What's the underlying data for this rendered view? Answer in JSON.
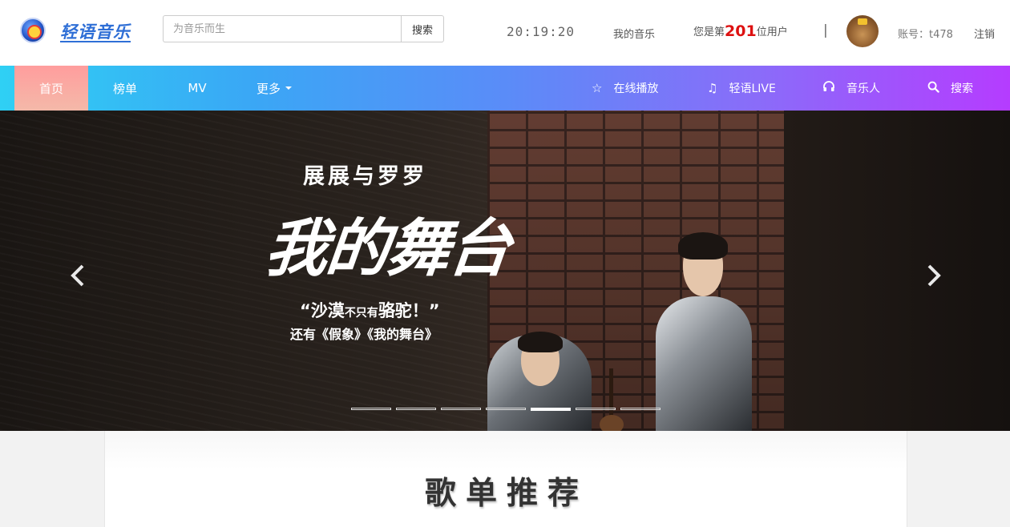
{
  "header": {
    "logo_text": "轻语音乐",
    "search_placeholder": "为音乐而生",
    "search_button": "搜索",
    "clock": "20:19:20",
    "my_music": "我的音乐",
    "user_count_prefix": "您是第",
    "user_count_number": "201",
    "user_count_suffix": "位用户",
    "divider": "|",
    "account": "账号：t478",
    "logout": "注销"
  },
  "nav": {
    "items": [
      {
        "label": "首页",
        "active": true
      },
      {
        "label": "榜单"
      },
      {
        "label": "MV"
      },
      {
        "label": "更多"
      }
    ],
    "right_items": [
      {
        "label": "在线播放",
        "icon": "star-icon"
      },
      {
        "label": "轻语LIVE",
        "icon": "music-note-icon"
      },
      {
        "label": "音乐人",
        "icon": "headphones-icon"
      },
      {
        "label": "搜索",
        "icon": "search-icon"
      }
    ],
    "gradient_start": "#2fd0f4",
    "gradient_end": "#b53cff",
    "active_color": "#ff9d9d"
  },
  "banner": {
    "subtitle": "展展与罗罗",
    "title": "我的舞台",
    "quote_part1": "“沙漠",
    "quote_small": "不只有",
    "quote_part2": "骆驼！”",
    "line": "还有《假象》《我的舞台》",
    "slide_count": 7,
    "active_slide": 5
  },
  "main": {
    "section_title": "歌单推荐"
  }
}
